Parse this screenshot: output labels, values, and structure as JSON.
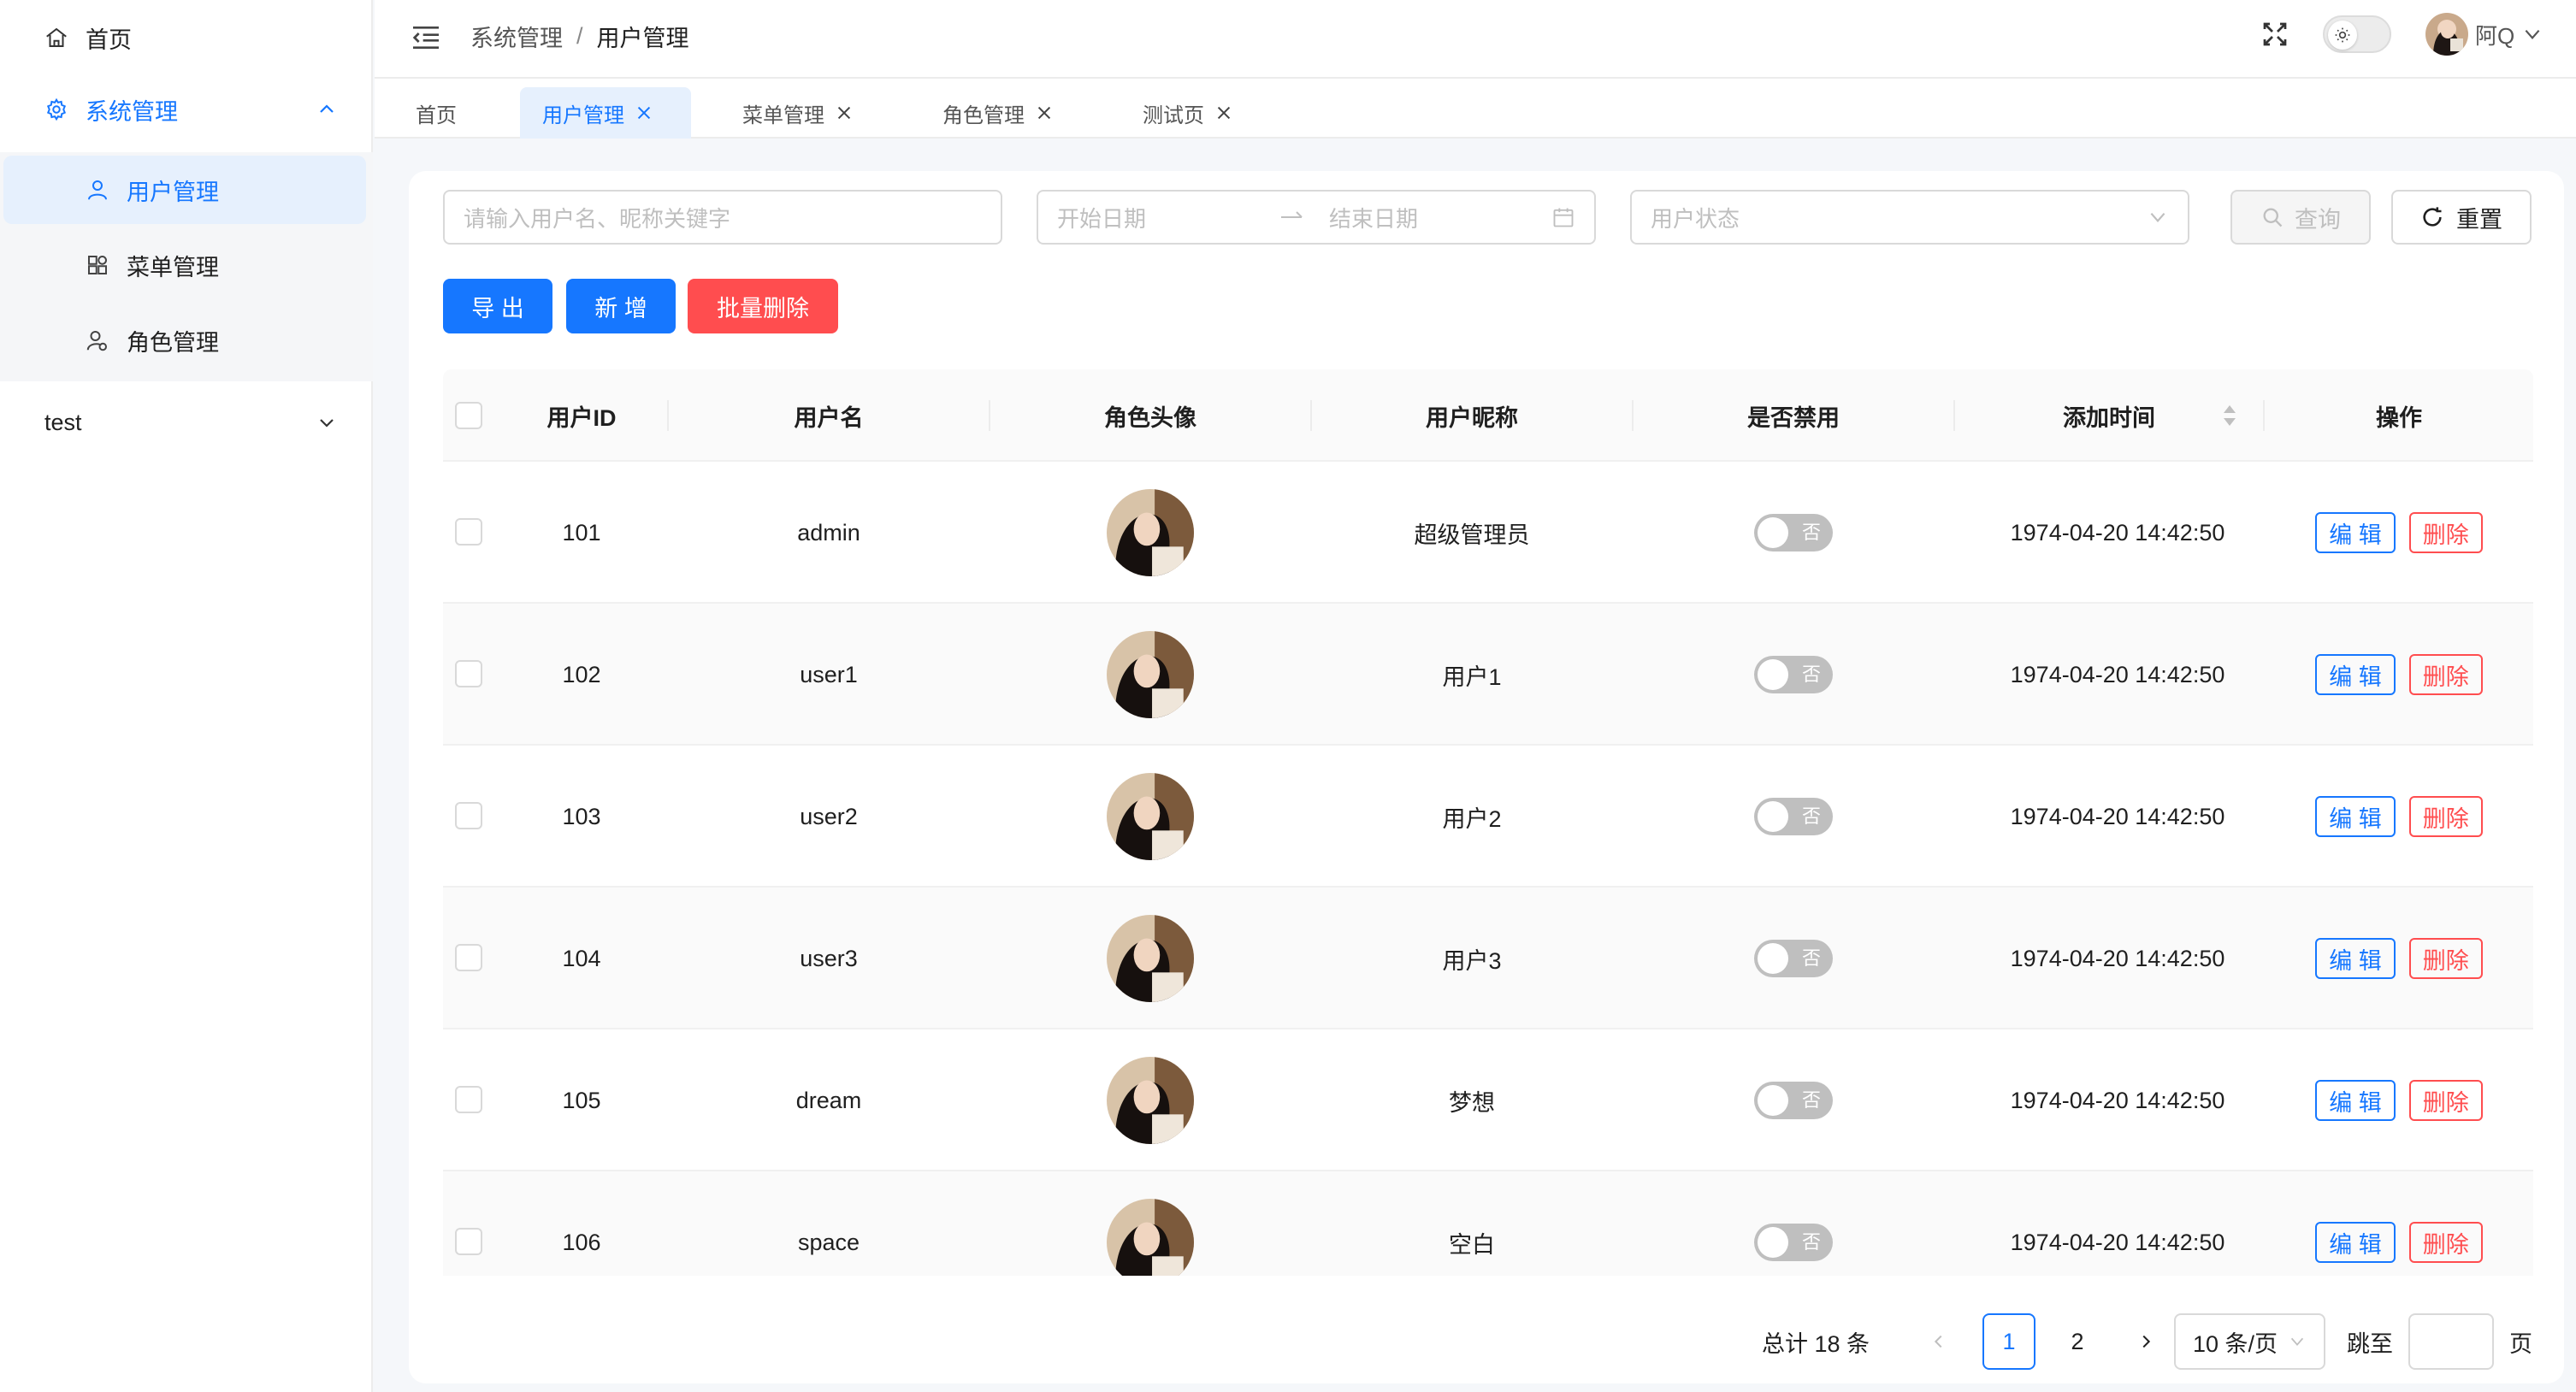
{
  "sidebar": {
    "items": [
      {
        "label": "首页",
        "icon": "home-icon"
      },
      {
        "label": "系统管理",
        "icon": "gear-icon",
        "expanded": true
      },
      {
        "label": "test",
        "icon": "",
        "expanded": false
      }
    ],
    "submenu": [
      {
        "label": "用户管理",
        "icon": "user-icon",
        "active": true
      },
      {
        "label": "菜单管理",
        "icon": "grid-icon"
      },
      {
        "label": "角色管理",
        "icon": "role-icon"
      }
    ]
  },
  "header": {
    "breadcrumb": [
      "系统管理",
      "用户管理"
    ],
    "breadcrumb_sep": "/",
    "username": "阿Q"
  },
  "tabs": [
    {
      "label": "首页",
      "closable": false
    },
    {
      "label": "用户管理",
      "closable": true,
      "active": true
    },
    {
      "label": "菜单管理",
      "closable": true
    },
    {
      "label": "角色管理",
      "closable": true
    },
    {
      "label": "测试页",
      "closable": true
    }
  ],
  "filters": {
    "keyword_placeholder": "请输入用户名、昵称关键字",
    "start_date_placeholder": "开始日期",
    "end_date_placeholder": "结束日期",
    "status_placeholder": "用户状态",
    "query_label": "查询",
    "reset_label": "重置"
  },
  "actions": {
    "export_label": "导 出",
    "add_label": "新 增",
    "batch_delete_label": "批量删除"
  },
  "table": {
    "columns": [
      "用户ID",
      "用户名",
      "角色头像",
      "用户昵称",
      "是否禁用",
      "添加时间",
      "操作"
    ],
    "rows": [
      {
        "id": "101",
        "username": "admin",
        "nickname": "超级管理员",
        "disabled": "否",
        "created": "1974-04-20 14:42:50"
      },
      {
        "id": "102",
        "username": "user1",
        "nickname": "用户1",
        "disabled": "否",
        "created": "1974-04-20 14:42:50"
      },
      {
        "id": "103",
        "username": "user2",
        "nickname": "用户2",
        "disabled": "否",
        "created": "1974-04-20 14:42:50"
      },
      {
        "id": "104",
        "username": "user3",
        "nickname": "用户3",
        "disabled": "否",
        "created": "1974-04-20 14:42:50"
      },
      {
        "id": "105",
        "username": "dream",
        "nickname": "梦想",
        "disabled": "否",
        "created": "1974-04-20 14:42:50"
      },
      {
        "id": "106",
        "username": "space",
        "nickname": "空白",
        "disabled": "否",
        "created": "1974-04-20 14:42:50"
      }
    ],
    "edit_label": "编 辑",
    "delete_label": "删除"
  },
  "pagination": {
    "total_text": "总计 18 条",
    "pages": [
      "1",
      "2"
    ],
    "current_page": "1",
    "page_size": "10 条/页",
    "jump_label": "跳至",
    "page_suffix": "页"
  },
  "colors": {
    "primary": "#1677ff",
    "danger": "#ff4d4f",
    "active_bg": "#e6f0fd"
  }
}
